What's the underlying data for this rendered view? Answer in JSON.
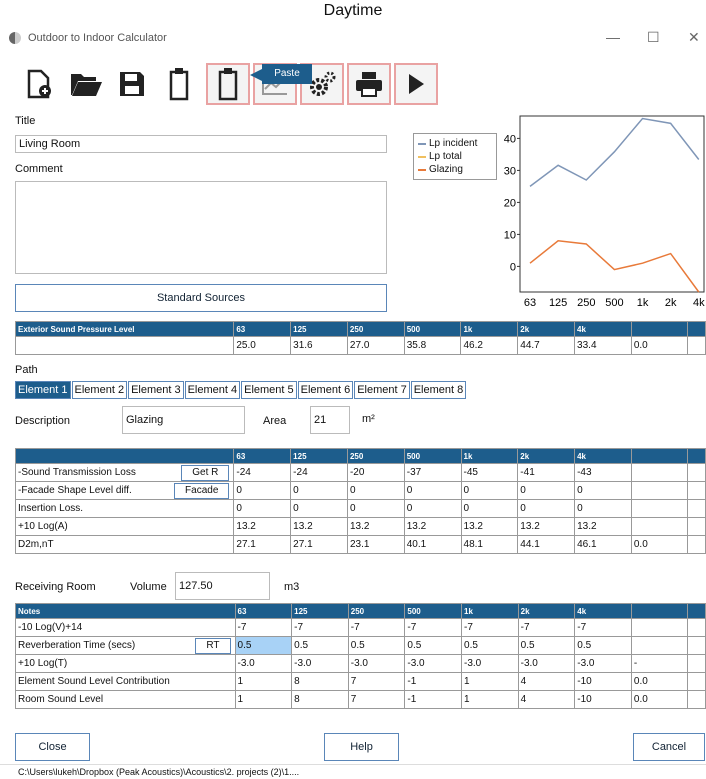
{
  "caption": "Daytime",
  "app_title": "Outdoor to Indoor Calculator",
  "window_controls": {
    "minimize": "—",
    "maximize": "☐",
    "close": "✕"
  },
  "toolbar": {
    "tooltip": "Paste",
    "buttons": [
      "new-doc-icon",
      "open-folder-icon",
      "save-icon",
      "copy-icon",
      "paste-icon",
      "chart-icon",
      "settings-icon",
      "print-icon",
      "play-icon"
    ]
  },
  "form": {
    "title_label": "Title",
    "title_value": "Living Room",
    "comment_label": "Comment",
    "comment_value": "",
    "standard_sources": "Standard Sources"
  },
  "legend": [
    "Lp incident",
    "Lp total",
    "Glazing"
  ],
  "colors": {
    "lp_incident": "#7f96b7",
    "lp_total": "#f0c060",
    "glazing": "#e87a3a",
    "header": "#1d5d8c",
    "selected": "#a8d2f6"
  },
  "chart_data": {
    "type": "line",
    "categories": [
      "63",
      "125",
      "250",
      "500",
      "1k",
      "2k",
      "4k"
    ],
    "ylim": [
      -8,
      47
    ],
    "yticks": [
      "40",
      "30",
      "20",
      "10",
      "0"
    ],
    "yticks_values": [
      40,
      30,
      20,
      10,
      0
    ],
    "series": [
      {
        "name": "Lp incident",
        "values": [
          25.0,
          31.6,
          27.0,
          35.8,
          46.2,
          44.7,
          33.4
        ]
      },
      {
        "name": "Glazing",
        "values": [
          1,
          8,
          7,
          -1,
          1,
          4,
          -10
        ]
      }
    ]
  },
  "exterior": {
    "header": [
      "Exterior Sound Pressure Level",
      "63",
      "125",
      "250",
      "500",
      "1k",
      "2k",
      "4k",
      "",
      ""
    ],
    "row": [
      "",
      "25.0",
      "31.6",
      "27.0",
      "35.8",
      "46.2",
      "44.7",
      "33.4",
      "0.0",
      ""
    ]
  },
  "path_label": "Path",
  "tabs": [
    "Element 1",
    "Element 2",
    "Element 3",
    "Element 4",
    "Element 5",
    "Element 6",
    "Element 7",
    "Element 8"
  ],
  "element": {
    "description_label": "Description",
    "description_value": "Glazing",
    "area_label": "Area",
    "area_value": "21",
    "area_unit": "m²"
  },
  "element_table": {
    "header": [
      "",
      "63",
      "125",
      "250",
      "500",
      "1k",
      "2k",
      "4k",
      "",
      ""
    ],
    "rows": [
      {
        "label": "-Sound Transmission Loss",
        "btn": "Get R",
        "vals": [
          "-24",
          "-24",
          "-20",
          "-37",
          "-45",
          "-41",
          "-43",
          "",
          ""
        ]
      },
      {
        "label": "-Facade Shape Level diff.",
        "btn": "Facade",
        "vals": [
          "0",
          "0",
          "0",
          "0",
          "0",
          "0",
          "0",
          "",
          ""
        ]
      },
      {
        "label": "Insertion Loss.",
        "btn": "",
        "vals": [
          "0",
          "0",
          "0",
          "0",
          "0",
          "0",
          "0",
          "",
          ""
        ]
      },
      {
        "label": "+10 Log(A)",
        "btn": "",
        "vals": [
          "13.2",
          "13.2",
          "13.2",
          "13.2",
          "13.2",
          "13.2",
          "13.2",
          "",
          ""
        ]
      },
      {
        "label": "D2m,nT",
        "btn": "",
        "vals": [
          "27.1",
          "27.1",
          "23.1",
          "40.1",
          "48.1",
          "44.1",
          "46.1",
          "0.0",
          ""
        ]
      }
    ]
  },
  "room": {
    "label": "Receiving Room",
    "volume_label": "Volume",
    "volume_value": "127.50",
    "volume_unit": "m3"
  },
  "room_table": {
    "header": [
      "Notes",
      "63",
      "125",
      "250",
      "500",
      "1k",
      "2k",
      "4k",
      "",
      ""
    ],
    "rows": [
      {
        "label": "-10 Log(V)+14",
        "btn": "",
        "vals": [
          "-7",
          "-7",
          "-7",
          "-7",
          "-7",
          "-7",
          "-7",
          "",
          ""
        ]
      },
      {
        "label": "Reverberation Time (secs)",
        "btn": "RT",
        "vals": [
          "0.5",
          "0.5",
          "0.5",
          "0.5",
          "0.5",
          "0.5",
          "0.5",
          "",
          ""
        ]
      },
      {
        "label": "+10 Log(T)",
        "btn": "",
        "vals": [
          "-3.0",
          "-3.0",
          "-3.0",
          "-3.0",
          "-3.0",
          "-3.0",
          "-3.0",
          "-",
          ""
        ]
      },
      {
        "label": "Element Sound Level Contribution",
        "btn": "",
        "vals": [
          "1",
          "8",
          "7",
          "-1",
          "1",
          "4",
          "-10",
          "0.0",
          ""
        ]
      },
      {
        "label": "Room Sound Level",
        "btn": "",
        "vals": [
          "1",
          "8",
          "7",
          "-1",
          "1",
          "4",
          "-10",
          "0.0",
          ""
        ]
      }
    ]
  },
  "footer": {
    "close": "Close",
    "help": "Help",
    "cancel": "Cancel"
  },
  "status_path": "C:\\Users\\lukeh\\Dropbox (Peak Acoustics)\\Acoustics\\2. projects (2)\\1...."
}
